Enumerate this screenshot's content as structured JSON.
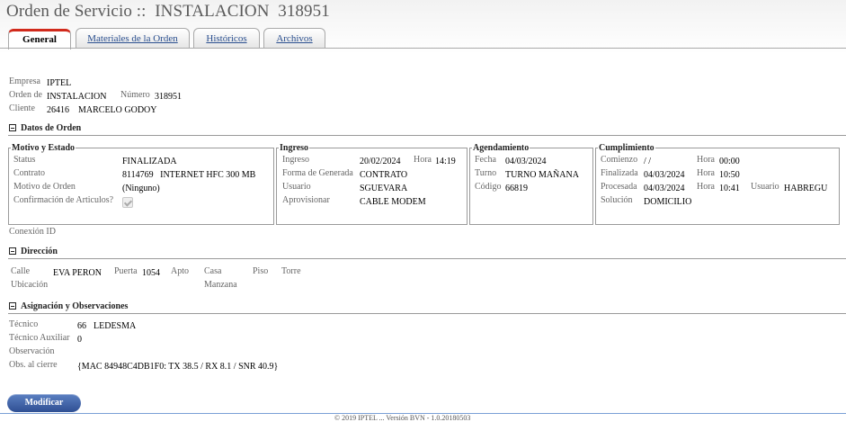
{
  "header": {
    "title": "Orden de Servicio ::  INSTALACION  318951"
  },
  "tabs": [
    {
      "label": "General",
      "active": true
    },
    {
      "label": "Materiales de la Orden",
      "active": false
    },
    {
      "label": "Históricos",
      "active": false
    },
    {
      "label": "Archivos",
      "active": false
    }
  ],
  "general": {
    "empresa_label": "Empresa",
    "empresa": "IPTEL",
    "orden_label": "Orden de",
    "orden": "INSTALACION",
    "numero_label": "Número",
    "numero": "318951",
    "cliente_label": "Cliente",
    "cliente_id": "26416",
    "cliente_nombre": "MARCELO GODOY"
  },
  "datos_orden": {
    "title": "Datos de Orden",
    "motivo": {
      "title": "Motivo y Estado",
      "status_label": "Status",
      "status": "FINALIZADA",
      "contrato_label": "Contrato",
      "contrato": "8114769   INTERNET HFC 300 MB",
      "motivo_label": "Motivo de Orden",
      "motivo": "(Ninguno)",
      "confirmacion_label": "Confirmación de Articulos?"
    },
    "ingreso": {
      "title": "Ingreso",
      "ingreso_label": "Ingreso",
      "ingreso": "20/02/2024",
      "hora_label": "Hora",
      "hora": "14:19",
      "forma_label": "Forma de Generada",
      "forma": "CONTRATO",
      "usuario_label": "Usuario",
      "usuario": "SGUEVARA",
      "aprovisionar_label": "Aprovisionar",
      "aprovisionar": "CABLE MODEM"
    },
    "agendamiento": {
      "title": "Agendamiento",
      "fecha_label": "Fecha",
      "fecha": "04/03/2024",
      "turno_label": "Turno",
      "turno": "TURNO MAÑANA",
      "codigo_label": "Código",
      "codigo": "66819"
    },
    "cumplimiento": {
      "title": "Cumplimiento",
      "comienzo_label": "Comienzo",
      "comienzo": "/ /",
      "comienzo_hora_label": "Hora",
      "comienzo_hora": "00:00",
      "finalizada_label": "Finalizada",
      "finalizada": "04/03/2024",
      "finalizada_hora_label": "Hora",
      "finalizada_hora": "10:50",
      "procesada_label": "Procesada",
      "procesada": "04/03/2024",
      "procesada_hora_label": "Hora",
      "procesada_hora": "10:41",
      "usuario_label": "Usuario",
      "usuario": "HABREGU",
      "solucion_label": "Solución",
      "solucion": "DOMICILIO"
    },
    "conexion_label": "Conexión ID"
  },
  "direccion": {
    "title": "Dirección",
    "calle_label": "Calle",
    "calle": "EVA PERON",
    "puerta_label": "Puerta",
    "puerta": "1054",
    "apto_label": "Apto",
    "casa_label": "Casa",
    "piso_label": "Piso",
    "torre_label": "Torre",
    "ubicacion_label": "Ubicación",
    "manzana_label": "Manzana"
  },
  "asignacion": {
    "title": "Asignación y Observaciones",
    "tecnico_label": "Técnico",
    "tecnico_id": "66",
    "tecnico_nombre": "LEDESMA",
    "tecnico_aux_label": "Técnico Auxiliar",
    "tecnico_aux": "0",
    "observacion_label": "Observación",
    "obs_cierre_label": "Obs. al cierre",
    "obs_cierre": "{MAC 84948C4DB1F0: TX 38.5 / RX 8.1 / SNR 40.9}"
  },
  "actions": {
    "modificar_label": "Modificar"
  },
  "footer": {
    "text": "© 2019 IPTEL ... Versión BVN - 1.0.20180503"
  }
}
